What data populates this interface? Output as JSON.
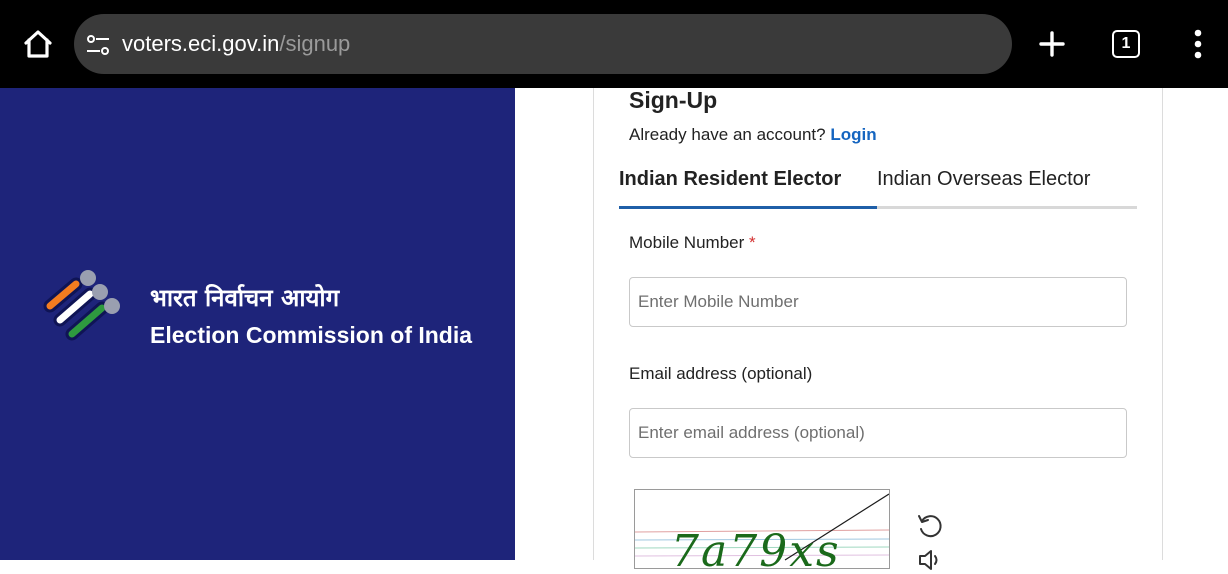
{
  "browser": {
    "url_domain": "voters.eci.gov.in",
    "url_path": "/signup",
    "tab_count": "1",
    "icons": {
      "home": "home-icon",
      "site_settings": "tune-icon",
      "new_tab": "plus-icon",
      "tabs": "tab-switcher-icon",
      "menu": "more-vert-icon"
    }
  },
  "brand": {
    "hindi_name": "भारत निर्वाचन आयोग",
    "english_name": "Election Commission of India",
    "panel_color": "#1e247a",
    "logo_colors": [
      "#f47c20",
      "#ffffff",
      "#2e9a3f",
      "#9a9fb0"
    ]
  },
  "form": {
    "title": "Sign-Up",
    "account_prompt": "Already have an account?",
    "login_label": "Login",
    "tabs": [
      {
        "label": "Indian Resident Elector",
        "active": true
      },
      {
        "label": "Indian Overseas Elector",
        "active": false
      }
    ],
    "mobile": {
      "label": "Mobile Number",
      "required_mark": "*",
      "placeholder": "Enter Mobile Number",
      "value": ""
    },
    "email": {
      "label": "Email address (optional)",
      "placeholder": "Enter email address (optional)",
      "value": ""
    },
    "captcha": {
      "text": "7a79xs",
      "text_color": "#1b6a1b"
    },
    "accent_color": "#1565c0"
  }
}
